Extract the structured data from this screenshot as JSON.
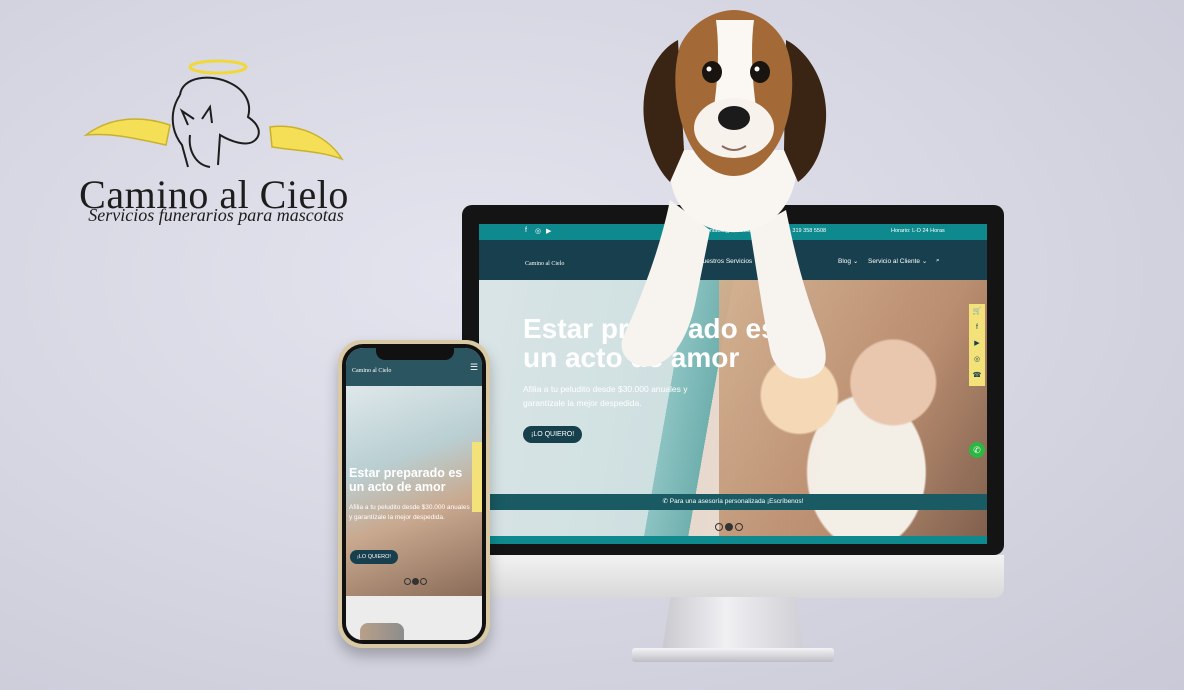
{
  "brand": {
    "name": "Camino al Cielo",
    "tagline": "Servicios funerarios para mascotas",
    "halo_color": "#f1d83a",
    "wing_color": "#f1d83a"
  },
  "desktop_site": {
    "topbar": {
      "social_icons": [
        "facebook-icon",
        "instagram-icon",
        "youtube-icon"
      ],
      "contact": "contacto@caminoalcielo.com.co",
      "phone_partial": "7 · 319 358 5508",
      "hours": "Horario: L-D 24 Horas"
    },
    "nav": {
      "logo_text": "Camino al Cielo",
      "items": [
        "Nuestros Servicios ⌄",
        "N",
        "Blog ⌄",
        "Servicio al Cliente ⌄"
      ],
      "search_icon": "search-icon"
    },
    "hero": {
      "title_line1": "Estar preparado es",
      "title_line2": "un acto de amor",
      "subtitle": "Afilia a tu peludito desde $30.000 anuales y garantízale la mejor despedida.",
      "cta": "¡LO QUIERO!"
    },
    "side_icons": [
      "cart-icon",
      "facebook-icon",
      "youtube-icon",
      "instagram-icon",
      "phone-icon"
    ],
    "whatsapp_strip": "Para una asesoría personalizada ¡Escríbenos!",
    "accent_teal": "#0e8a8e",
    "nav_dark": "#173f4d"
  },
  "mobile_site": {
    "logo_text": "Camino al Cielo",
    "hero": {
      "title_line1": "Estar preparado es",
      "title_line2": "un acto de amor",
      "subtitle": "Afilia a tu peludito desde $30.000 anuales y garantízale la mejor despedida.",
      "cta": "¡LO QUIERO!"
    }
  }
}
